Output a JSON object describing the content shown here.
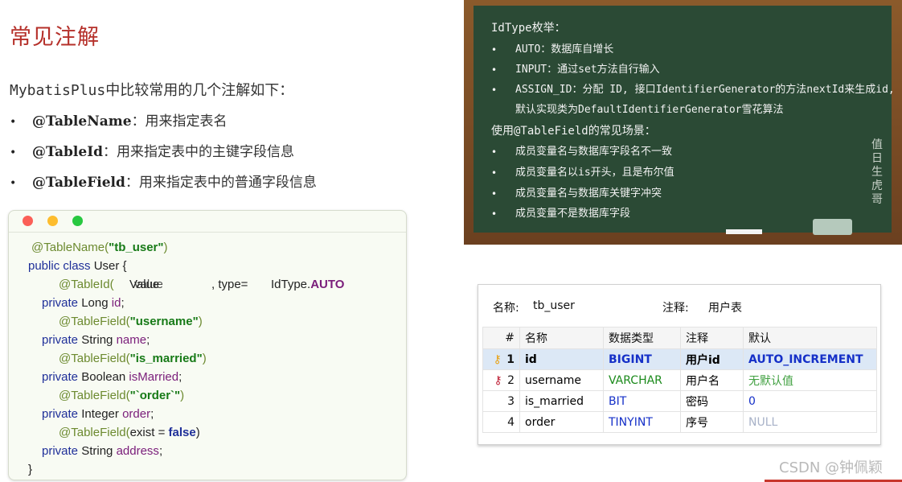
{
  "heading": "常见注解",
  "intro": "MybatisPlus中比较常用的几个注解如下：",
  "bullets": [
    {
      "name": "@TableName",
      "desc": "：用来指定表名"
    },
    {
      "name": "@TableId",
      "desc": "：用来指定表中的主键字段信息"
    },
    {
      "name": "@TableField",
      "desc": "：用来指定表中的普通字段信息"
    }
  ],
  "code": {
    "l1_ann": "@TableName(",
    "l1_str": "\"tb_user\"",
    "l1_close": ")",
    "l2_kw": "public class",
    "l2_rest": " User {",
    "l3_ann": "@TableId(",
    "l3_v1": "value",
    "l3_v2": "Value",
    "l3_type": ", type=",
    "l3_enum": "IdType.",
    "l3_const": "AUTO",
    "l4_kw": "private",
    "l4_type": " Long ",
    "l4_fld": "id",
    "l4_semi": ";",
    "l5_ann": "@TableField(",
    "l5_str": "\"username\"",
    "l5_close": ")",
    "l6_kw": "private",
    "l6_type": " String ",
    "l6_fld": "name",
    "l6_semi": ";",
    "l7_ann": "@TableField(",
    "l7_str": "\"is_married\"",
    "l7_close": ")",
    "l8_kw": "private",
    "l8_type": " Boolean ",
    "l8_fld": "isMarried",
    "l8_semi": ";",
    "l9_ann": "@TableField(",
    "l9_str": "\"`order`\"",
    "l9_close": ")",
    "l10_kw": "private",
    "l10_type": " Integer ",
    "l10_fld": "order",
    "l10_semi": ";",
    "l11_ann": "@TableField(",
    "l11_mid": "exist = ",
    "l11_kw": "false",
    "l11_close": ")",
    "l12_kw": "private",
    "l12_type": " String ",
    "l12_fld": "address",
    "l12_semi": ";",
    "l13": "}"
  },
  "board": {
    "idtype_title": "IdType枚举：",
    "idtype_items": [
      "AUTO：数据库自增长",
      "INPUT：通过set方法自行输入",
      "ASSIGN_ID：分配 ID, 接口IdentifierGenerator的方法nextId来生成id,",
      "默认实现类为DefaultIdentifierGenerator雪花算法"
    ],
    "field_title": "使用@TableField的常见场景：",
    "field_items": [
      "成员变量名与数据库字段名不一致",
      "成员变量名以is开头，且是布尔值",
      "成员变量名与数据库关键字冲突",
      "成员变量不是数据库字段"
    ],
    "signature": [
      "值",
      "日",
      "生",
      "虎",
      "哥"
    ]
  },
  "db": {
    "name_label": "名称:",
    "name_value": "tb_user",
    "comment_label": "注释:",
    "comment_value": "用户表",
    "headers": [
      "#",
      "名称",
      "数据类型",
      "注释",
      "默认"
    ],
    "rows": [
      {
        "num": "1",
        "name": "id",
        "type": "BIGINT",
        "comment": "用户id",
        "default": "AUTO_INCREMENT"
      },
      {
        "num": "2",
        "name": "username",
        "type": "VARCHAR",
        "comment": "用户名",
        "default": "无默认值"
      },
      {
        "num": "3",
        "name": "is_married",
        "type": "BIT",
        "comment": "密码",
        "default": "0"
      },
      {
        "num": "4",
        "name": "order",
        "type": "TINYINT",
        "comment": "序号",
        "default": "NULL"
      }
    ]
  },
  "watermark": "CSDN @钟佩颖"
}
